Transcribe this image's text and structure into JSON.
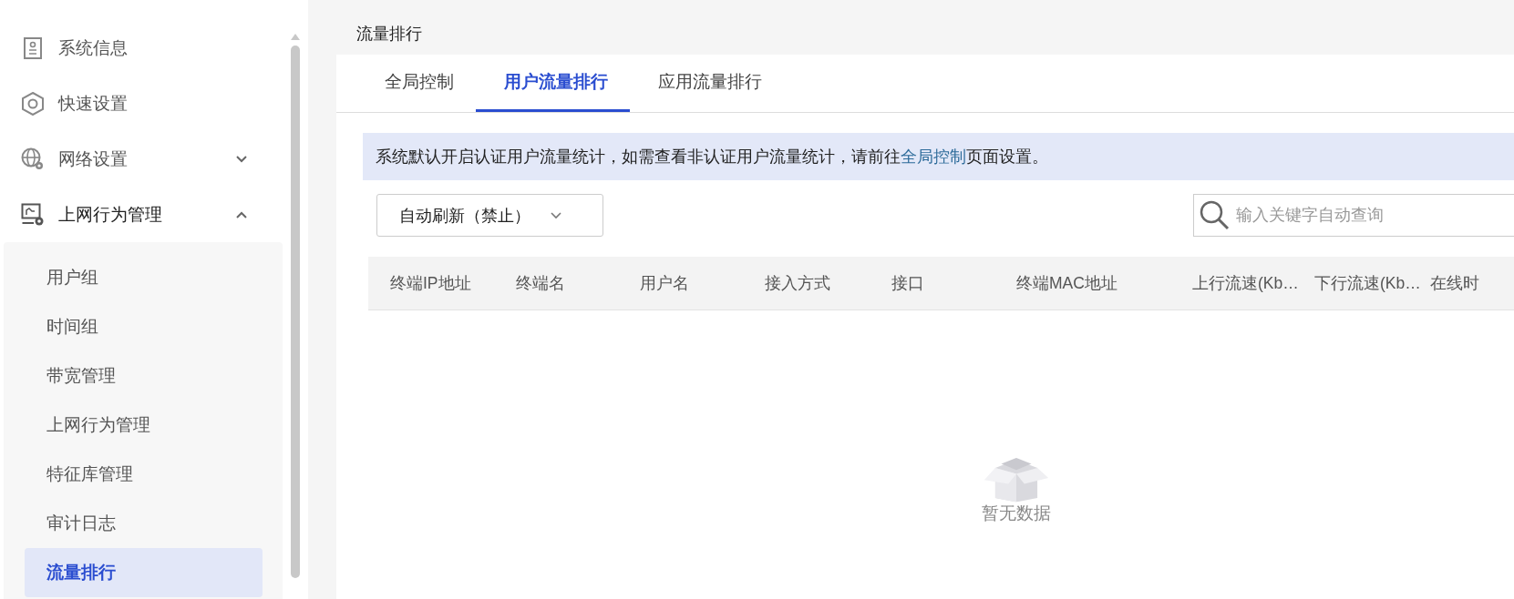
{
  "sidebar": {
    "items": [
      {
        "label": "系统信息"
      },
      {
        "label": "快速设置"
      },
      {
        "label": "网络设置",
        "expanded": false
      },
      {
        "label": "上网行为管理",
        "expanded": true,
        "children": [
          {
            "label": "用户组",
            "selected": false
          },
          {
            "label": "时间组",
            "selected": false
          },
          {
            "label": "带宽管理",
            "selected": false
          },
          {
            "label": "上网行为管理",
            "selected": false
          },
          {
            "label": "特征库管理",
            "selected": false
          },
          {
            "label": "审计日志",
            "selected": false
          },
          {
            "label": "流量排行",
            "selected": true
          }
        ]
      }
    ]
  },
  "page": {
    "title": "流量排行"
  },
  "tabs": [
    {
      "label": "全局控制",
      "selected": false
    },
    {
      "label": "用户流量排行",
      "selected": true
    },
    {
      "label": "应用流量排行",
      "selected": false
    }
  ],
  "notice": {
    "before": "系统默认开启认证用户流量统计，如需查看非认证用户流量统计，请前往",
    "link": "全局控制",
    "after": "页面设置。"
  },
  "refresh_dropdown": {
    "value": "自动刷新（禁止）"
  },
  "search": {
    "placeholder": "输入关键字自动查询"
  },
  "table": {
    "columns": [
      "终端IP地址",
      "终端名",
      "用户名",
      "接入方式",
      "接口",
      "终端MAC地址",
      "上行流速(Kb…",
      "下行流速(Kb…",
      "在线时"
    ],
    "empty_text": "暂无数据"
  }
}
